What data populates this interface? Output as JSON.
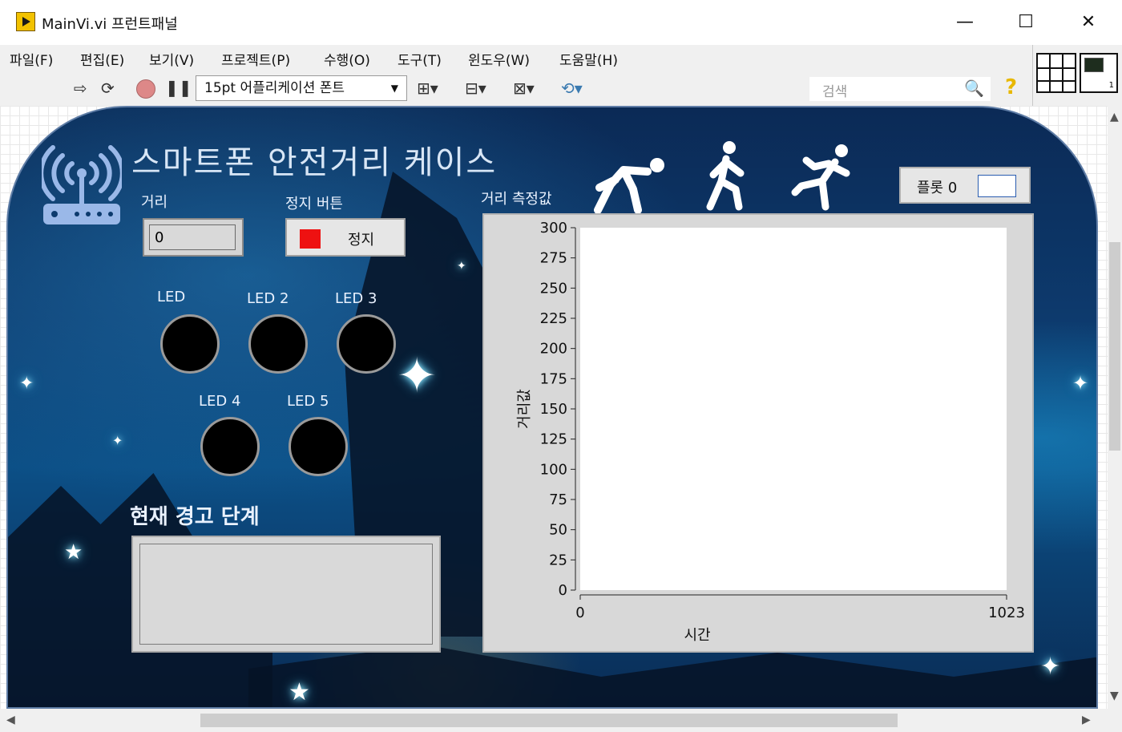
{
  "window": {
    "title": "MainVi.vi 프런트패널",
    "minimize": "—",
    "maximize": "☐",
    "close": "✕"
  },
  "menu": [
    "파일(F)",
    "편집(E)",
    "보기(V)",
    "프로젝트(P)",
    "수행(O)",
    "도구(T)",
    "윈도우(W)",
    "도움말(H)"
  ],
  "toolbar": {
    "font": "15pt 어플리케이션 폰트",
    "search_placeholder": "검색",
    "help": "?"
  },
  "panel": {
    "title": "스마트폰 안전거리 케이스",
    "distance_label": "거리",
    "distance_value": "0",
    "stop_label": "정지 버튼",
    "stop_button": "정지",
    "leds": [
      {
        "label": "LED",
        "on": false
      },
      {
        "label": "LED 2",
        "on": false
      },
      {
        "label": "LED 3",
        "on": false
      },
      {
        "label": "LED 4",
        "on": false
      },
      {
        "label": "LED 5",
        "on": false
      }
    ],
    "warning_label": "현재 경고 단계",
    "warning_value": "",
    "graph_label": "거리 측정값",
    "legend": "플롯 0"
  },
  "chart_data": {
    "type": "line",
    "title": "거리 측정값",
    "xlabel": "시간",
    "ylabel": "거리값",
    "xlim": [
      0,
      1023
    ],
    "ylim": [
      0,
      300
    ],
    "x_ticks": [
      "0",
      "1023"
    ],
    "y_ticks": [
      "300",
      "275",
      "250",
      "225",
      "200",
      "175",
      "150",
      "125",
      "100",
      "75",
      "50",
      "25",
      "0"
    ],
    "series": [
      {
        "name": "플롯 0",
        "values": []
      }
    ],
    "grid": false,
    "legend": "top-right"
  },
  "colors": {
    "stop_indicator": "#ee1111",
    "led_off": "#000000",
    "panel_bg": "#0c3a6d"
  }
}
